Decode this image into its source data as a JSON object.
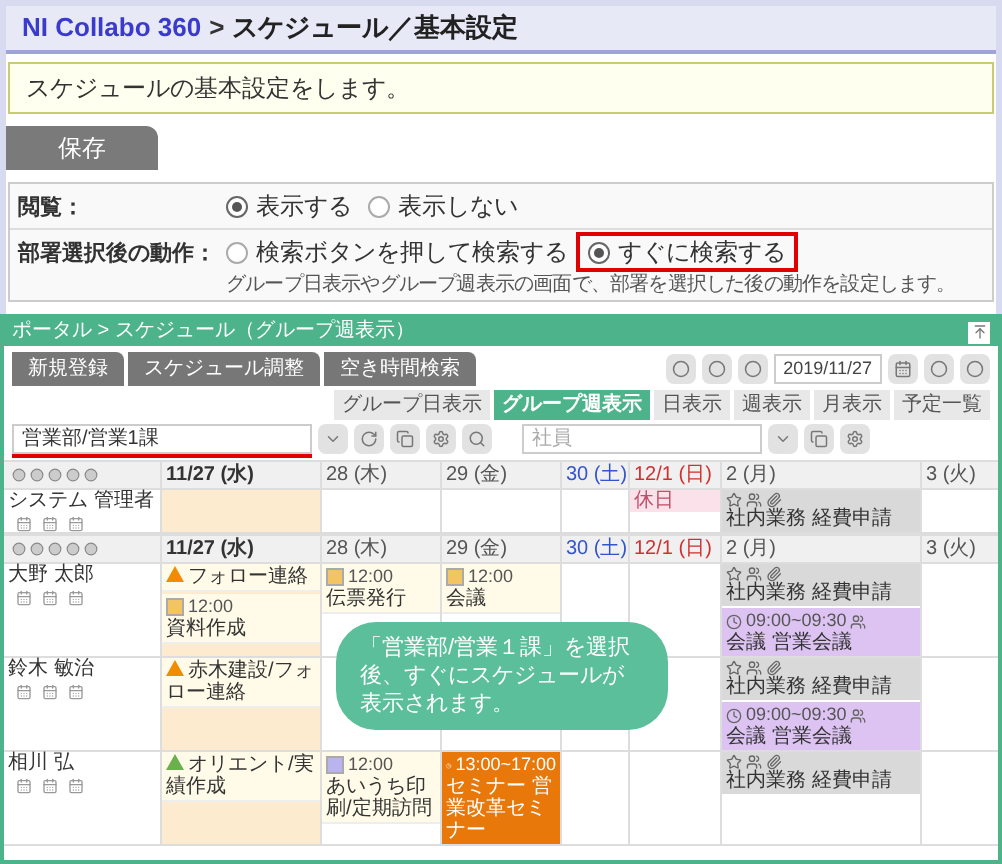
{
  "breadcrumb": {
    "app": "NI Collabo 360",
    "separator": ">",
    "page": "スケジュール／基本設定"
  },
  "description": "スケジュールの基本設定をします。",
  "save_button": "保存",
  "settings": [
    {
      "label": "閲覧：",
      "options": [
        {
          "label": "表示する",
          "selected": true,
          "highlighted": false
        },
        {
          "label": "表示しない",
          "selected": false,
          "highlighted": false
        }
      ]
    },
    {
      "label": "部署選択後の動作：",
      "options": [
        {
          "label": "検索ボタンを押して検索する",
          "selected": false,
          "highlighted": false
        },
        {
          "label": "すぐに検索する",
          "selected": true,
          "highlighted": true
        }
      ],
      "note": "グループ日表示やグループ週表示の画面で、部署を選択した後の動作を設定します。"
    }
  ],
  "preview": {
    "title": "ポータル > スケジュール（グループ週表示）",
    "action_buttons": [
      "新規登録",
      "スケジュール調整",
      "空き時間検索"
    ],
    "date_field": {
      "value": "2019/11/27"
    },
    "view_tabs": [
      {
        "label": "グループ日表示",
        "selected": false
      },
      {
        "label": "グループ週表示",
        "selected": true
      },
      {
        "label": "日表示",
        "selected": false
      },
      {
        "label": "週表示",
        "selected": false
      },
      {
        "label": "月表示",
        "selected": false
      },
      {
        "label": "予定一覧",
        "selected": false
      }
    ],
    "department_field": {
      "value": "営業部/営業1課",
      "underlined": true
    },
    "employee_field": {
      "placeholder": "社員"
    },
    "rows": [
      {
        "kind": "header",
        "days": [
          {
            "label": "11/27 (水)",
            "kind": "today"
          },
          {
            "label": "28 (木)",
            "kind": "weekday"
          },
          {
            "label": "29 (金)",
            "kind": "weekday"
          },
          {
            "label": "30 (土)",
            "kind": "saturday"
          },
          {
            "label": "12/1 (日)",
            "kind": "sunday"
          },
          {
            "label": "2 (月)",
            "kind": "weekday"
          },
          {
            "label": "3 (火)",
            "kind": "weekday"
          }
        ]
      },
      {
        "kind": "user",
        "name": "システム 管理者",
        "cells": [
          null,
          null,
          null,
          null,
          [
            {
              "kind": "holiday",
              "title": "休日"
            }
          ],
          [
            {
              "kind": "workflow",
              "title": "社内業務 経費申請"
            }
          ],
          null
        ]
      },
      {
        "kind": "header",
        "days": [
          {
            "label": "11/27 (水)",
            "kind": "today"
          },
          {
            "label": "28 (木)",
            "kind": "weekday"
          },
          {
            "label": "29 (金)",
            "kind": "weekday"
          },
          {
            "label": "30 (土)",
            "kind": "saturday"
          },
          {
            "label": "12/1 (日)",
            "kind": "sunday"
          },
          {
            "label": "2 (月)",
            "kind": "weekday"
          },
          {
            "label": "3 (火)",
            "kind": "weekday"
          }
        ]
      },
      {
        "kind": "user",
        "name": "大野 太郎",
        "callout": "「営業部/営業１課」を選択後、すぐにスケジュールが表示されます。",
        "cells": [
          [
            {
              "kind": "todo",
              "color": "#f08c00",
              "title": "フォロー連絡"
            },
            {
              "kind": "schedule",
              "color": "#f2c462",
              "time": "12:00",
              "title": "資料作成"
            }
          ],
          [
            {
              "kind": "schedule",
              "color": "#f2c462",
              "time": "12:00",
              "title": "伝票発行"
            }
          ],
          [
            {
              "kind": "schedule",
              "color": "#f2c462",
              "time": "12:00",
              "title": "会議"
            }
          ],
          null,
          null,
          [
            {
              "kind": "workflow",
              "title": "社内業務 経費申請"
            },
            {
              "kind": "meeting",
              "time": "09:00~09:30",
              "title": "会議 営業会議"
            }
          ],
          null
        ]
      },
      {
        "kind": "user",
        "name": "鈴木 敏治",
        "cells": [
          [
            {
              "kind": "todo",
              "color": "#f08c00",
              "title": "赤木建設/フォロー連絡"
            }
          ],
          null,
          null,
          null,
          null,
          [
            {
              "kind": "workflow",
              "title": "社内業務 経費申請"
            },
            {
              "kind": "meeting",
              "time": "09:00~09:30",
              "title": "会議 営業会議"
            }
          ],
          null
        ]
      },
      {
        "kind": "user",
        "name": "相川 弘",
        "cells": [
          [
            {
              "kind": "todo",
              "color": "#6ab04c",
              "title": "オリエント/実績作成"
            }
          ],
          [
            {
              "kind": "schedule",
              "color": "#b9b4f0",
              "time": "12:00",
              "title": "あいうち印刷/定期訪問"
            }
          ],
          [
            {
              "kind": "seminar",
              "time": "13:00~17:00",
              "title": "セミナー 営業改革セミナー"
            }
          ],
          null,
          null,
          [
            {
              "kind": "workflow",
              "title": "社内業務 経費申請"
            }
          ],
          null
        ]
      }
    ]
  }
}
